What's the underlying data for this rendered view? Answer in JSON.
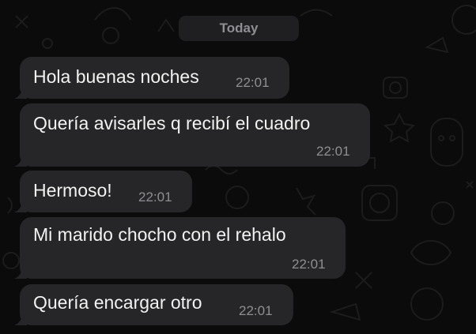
{
  "date_separator": "Today",
  "messages": [
    {
      "text": "Hola buenas noches",
      "time": "22:01"
    },
    {
      "text": "Quería avisarles q recibí el cuadro",
      "time": "22:01"
    },
    {
      "text": "Hermoso!",
      "time": "22:01"
    },
    {
      "text": "Mi marido chocho con el rehalo",
      "time": "22:01"
    },
    {
      "text": "Quería encargar otro",
      "time": "22:01"
    }
  ],
  "colors": {
    "background": "#0b0b0b",
    "bubble": "#262628",
    "text": "#f2f2f2",
    "timestamp": "#8e8e93",
    "date_pill": "#1f1f21"
  }
}
